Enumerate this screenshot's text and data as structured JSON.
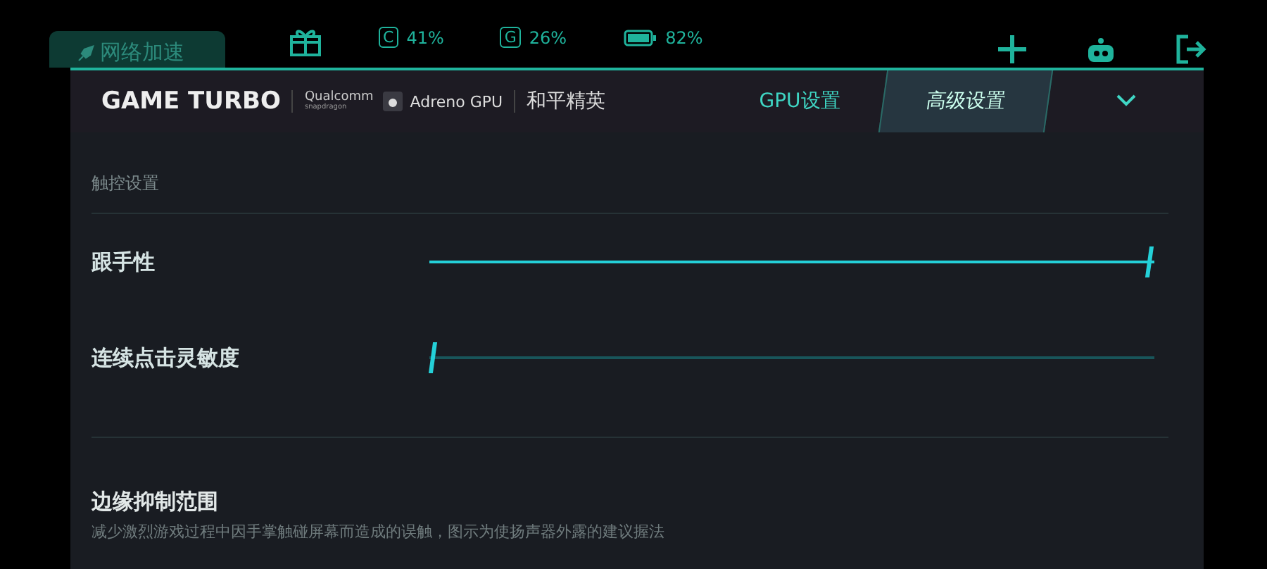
{
  "top_bar": {
    "network_tab": "网络加速",
    "stats": [
      {
        "letter": "C",
        "value": "41%"
      },
      {
        "letter": "G",
        "value": "26%"
      }
    ],
    "battery": "82%"
  },
  "header": {
    "title": "GAME TURBO",
    "chip_brand": "Qualcomm",
    "chip_sub": "snapdragon",
    "gpu": "Adreno GPU",
    "game": "和平精英",
    "tabs": [
      {
        "label": "GPU设置",
        "selected": false
      },
      {
        "label": "高级设置",
        "selected": true
      }
    ]
  },
  "section_title": "触控设置",
  "sliders": [
    {
      "label": "跟手性",
      "level": 1
    },
    {
      "label": "连续点击灵敏度",
      "level": 0
    }
  ],
  "edge": {
    "title": "边缘抑制范围",
    "description": "减少激烈游戏过程中因手掌触碰屏幕而造成的误触，图示为使扬声器外露的建议握法"
  }
}
